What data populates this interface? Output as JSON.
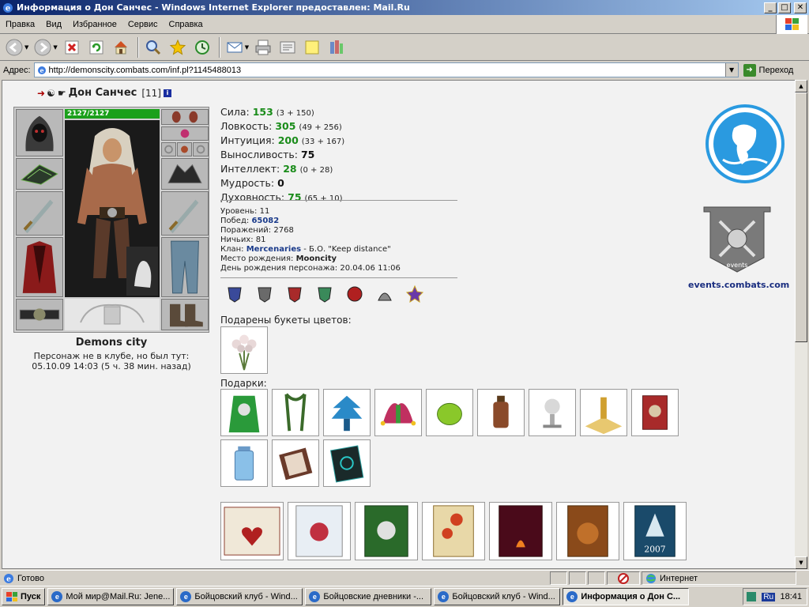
{
  "window": {
    "title": "Информация о Дон Санчес - Windows Internet Explorer предоставлен: Mail.Ru",
    "minimize_label": "_",
    "maximize_label": "□",
    "close_label": "✕"
  },
  "menu": [
    "Правка",
    "Вид",
    "Избранное",
    "Сервис",
    "Справка"
  ],
  "address": {
    "label": "Адрес:",
    "url": "http://demonscity.combats.com/inf.pl?1145488013",
    "go_label": "Переход"
  },
  "character": {
    "name": "Дон Санчес",
    "level": "[11]",
    "hp": "2127/2127",
    "city": "Demons city",
    "status_line1": "Персонаж не в клубе, но был тут:",
    "status_line2": "05.10.09 14:03 (5 ч. 38 мин. назад)"
  },
  "stats": [
    {
      "label": "Сила:",
      "value": "153",
      "bonus": "(3 + 150)",
      "color": "green"
    },
    {
      "label": "Ловкость:",
      "value": "305",
      "bonus": "(49 + 256)",
      "color": "green"
    },
    {
      "label": "Интуиция:",
      "value": "200",
      "bonus": "(33 + 167)",
      "color": "green"
    },
    {
      "label": "Выносливость:",
      "value": "75",
      "bonus": "",
      "color": "black"
    },
    {
      "label": "Интеллект:",
      "value": "28",
      "bonus": "(0 + 28)",
      "color": "green"
    },
    {
      "label": "Мудрость:",
      "value": "0",
      "bonus": "",
      "color": "black"
    },
    {
      "label": "Духовность:",
      "value": "75",
      "bonus": "(65 + 10)",
      "color": "green"
    }
  ],
  "details": {
    "level_label": "Уровень:",
    "level_value": "11",
    "wins_label": "Побед:",
    "wins_value": "65082",
    "losses_label": "Поражений:",
    "losses_value": "2768",
    "draws_label": "Ничьих:",
    "draws_value": "81",
    "clan_label": "Клан:",
    "clan_value": "Mercenaries",
    "clan_extra": "- Б.О. \"Keep distance\"",
    "birthplace_label": "Место рождения:",
    "birthplace_value": "Mooncity",
    "birthday_label": "День рождения персонажа:",
    "birthday_value": "20.04.06 11:06"
  },
  "sections": {
    "flowers": "Подарены букеты цветов:",
    "gifts": "Подарки:"
  },
  "events_link": "events.combats.com",
  "emblem_text": "events",
  "card_text": "2007",
  "statusbar": {
    "text": "Готово",
    "zone": "Интернет"
  },
  "taskbar": {
    "start": "Пуск",
    "tasks": [
      "Мой мир@Mail.Ru: Jene...",
      "Бойцовский клуб - Wind...",
      "Бойцовские дневники -...",
      "Бойцовский клуб - Wind...",
      "Информация о Дон С..."
    ],
    "lang": "Ru",
    "clock": "18:41"
  },
  "colors": {
    "stat_green": "#1a8c1a",
    "link_blue": "#1a3a8a",
    "hp_green": "#1aa01a",
    "title_bar": "#0a246a"
  }
}
